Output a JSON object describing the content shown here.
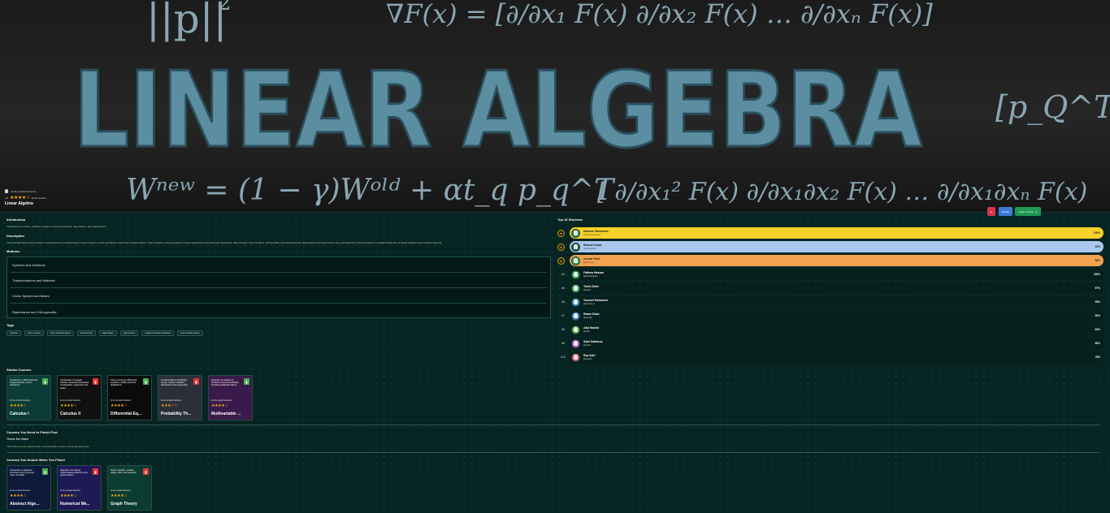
{
  "hero": {
    "banner_title": "LINEAR ALGEBRA",
    "formula_norm": "||p||",
    "formula_norm_sup": "2",
    "formula_gradient": "∇F(x) = [∂/∂x₁ F(x)  ∂/∂x₂ F(x)  …  ∂/∂xₙ F(x)]",
    "formula_update": "Wⁿᵉʷ = (1 − γ)Wᵒˡᵈ + αt_q p_q^T",
    "formula_hessian": "[ ∂/∂x₁² F(x)   ∂/∂x₁∂x₂ F(x) …  ∂/∂x₁∂xₙ F(x)",
    "formula_matrix": "[p_Q^T]",
    "enrolled": "4k 2k enrolled Students",
    "rating_value": "4.6",
    "rating_stars": "★★★★☆",
    "reviews": "3k 2k reviews",
    "course_title": "Linear Algebra"
  },
  "intro": {
    "heading": "Introduction",
    "text": "Introduction to vectors, matrices, systems of linear equations, eigenvalues, and eigenvectors."
  },
  "description": {
    "heading": "Description",
    "text": "This foundational course provides a comprehensive understanding of vector spaces, matrix operations, and linear transformations. Topics include: solving systems of linear equations using Gaussian elimination, determinants, inner products, orthogonality, and spectral theory. Eigenvalues and eigenvectors are emphasized for their importance in applied fields like computer graphics and machine learning."
  },
  "modules": {
    "heading": "Modules",
    "items": [
      "Systems and Solutions",
      "Transformations and Matrices",
      "Vector Spaces and Bases",
      "Eigenvalues and Orthogonality"
    ]
  },
  "tags": {
    "heading": "Tags",
    "items": [
      "matrices",
      "vector spaces",
      "linear transformations",
      "determinants",
      "eigenvalues",
      "eigenvectors",
      "systems of linear equations",
      "inner product spaces"
    ]
  },
  "similar": {
    "heading": "Similar Courses",
    "cards": [
      {
        "name": "Calculus I",
        "blurb": "Introduction to differential and integral calculus. Limits, derivatives",
        "meta": "4k 2k enrolled Students",
        "stars": "★★★★☆",
        "badge_color": "#4caf50",
        "bg": "#0d3b36"
      },
      {
        "name": "Calculus II",
        "blurb": "Continuation of integral calculus, advanced techniques of integration, sequences and series",
        "meta": "4k 2k enrolled Students",
        "stars": "★★★★☆",
        "badge_color": "#e53935",
        "bg": "#111"
      },
      {
        "name": "Differential Eq...",
        "blurb": "Study of ordinary differential equations (ODEs) and their applications",
        "meta": "4k 2k enrolled Students",
        "stars": "★★★★☆",
        "badge_color": "#4caf50",
        "bg": "#0b0b0b"
      },
      {
        "name": "Probability Th...",
        "blurb": "Fundamentals of probability: events, random variables, distributions and expectation",
        "meta": "4k 2k enrolled Students",
        "stars": "★★★☆☆",
        "badge_color": "#e53935",
        "bg": "#2c2f3a"
      },
      {
        "name": "Multivariable ...",
        "blurb": "Extension of calculus to functions of several variables, including partial derivatives",
        "meta": "4k 2k enrolled Students",
        "stars": "★★★★☆",
        "badge_color": "#4caf50",
        "bg": "#3a1a4a"
      }
    ]
  },
  "prereq": {
    "heading": "Courses You Need to Finish First",
    "subheading": "These Are None",
    "text_before": "This course ",
    "course_link": "Linear Algebra",
    "text_after": " has no prerequisite courses. Enrol and start now!"
  },
  "unlock": {
    "heading": "Courses You Unlock When You Finish",
    "cards": [
      {
        "name": "Abstract Alge...",
        "blurb": "Introduction to algebraic structures such as groups, rings, and fields",
        "meta": "4k 2k enrolled Students",
        "stars": "★★★★☆",
        "badge_color": "#4caf50",
        "bg": "#0d1a3a"
      },
      {
        "name": "Numerical Me...",
        "blurb": "Algorithms for solving mathematical problems using approximation",
        "meta": "4k 2k enrolled Students",
        "stars": "★★★★☆",
        "badge_color": "#e53935",
        "bg": "#1e1a55"
      },
      {
        "name": "Graph Theory",
        "blurb": "Study of graphs, vertices, edges, paths, and networks",
        "meta": "4k 2k enrolled Students",
        "stars": "★★★★☆",
        "badge_color": "#e53935",
        "bg": "#0c3b30"
      }
    ]
  },
  "leaderboard": {
    "title": "Top 10 Students",
    "buttons": {
      "report": "R",
      "info": "Details",
      "open": "Open Course"
    },
    "students": [
      {
        "rank": "#1",
        "name": "Hashem Wassouss",
        "handle": "@hashemwassouss",
        "pct": "100%",
        "bar": "#f8d12a",
        "avatar": "#2e8b57",
        "text": "#1b1b1b"
      },
      {
        "rank": "#2",
        "name": "Bishad Kasab",
        "handle": "@bishadkasab",
        "pct": "92%",
        "bar": "#aac8ef",
        "avatar": "#1f5d4a",
        "text": "#1b1b1b"
      },
      {
        "rank": "#3",
        "name": "Ammar Tarix",
        "handle": "@ammar_tx",
        "pct": "85%",
        "bar": "#f4a24f",
        "avatar": "#3aa55f",
        "text": "#1b1b1b"
      },
      {
        "rank": "#4",
        "name": "Fathma Hassan",
        "handle": "@fathmahassan",
        "pct": "100%",
        "bar": "",
        "avatar": "#3aa55f",
        "text": "#ffffff"
      },
      {
        "rank": "#5",
        "name": "Tarek Zaher",
        "handle": "@tarekz",
        "pct": "97%",
        "bar": "",
        "avatar": "#3aa55f",
        "text": "#ffffff"
      },
      {
        "rank": "#6",
        "name": "Youssef Mohamed",
        "handle": "@youssef_m",
        "pct": "95%",
        "bar": "",
        "avatar": "#2f8ccf",
        "text": "#ffffff"
      },
      {
        "rank": "#7",
        "name": "Rama Ghazi",
        "handle": "@ramagh",
        "pct": "90%",
        "bar": "",
        "avatar": "#4b7bd8",
        "text": "#ffffff"
      },
      {
        "rank": "#8",
        "name": "Zaid Rashid",
        "handle": "@zaidr",
        "pct": "82%",
        "bar": "",
        "avatar": "#58a83a",
        "text": "#ffffff"
      },
      {
        "rank": "#9",
        "name": "Sami Dabbous",
        "handle": "@samid",
        "pct": "80%",
        "bar": "",
        "avatar": "#c653c3",
        "text": "#ffffff"
      },
      {
        "rank": "#10",
        "name": "Rya Adel",
        "handle": "@ryaadel",
        "pct": "78%",
        "bar": "",
        "avatar": "#e04a6a",
        "text": "#ffffff"
      }
    ]
  }
}
